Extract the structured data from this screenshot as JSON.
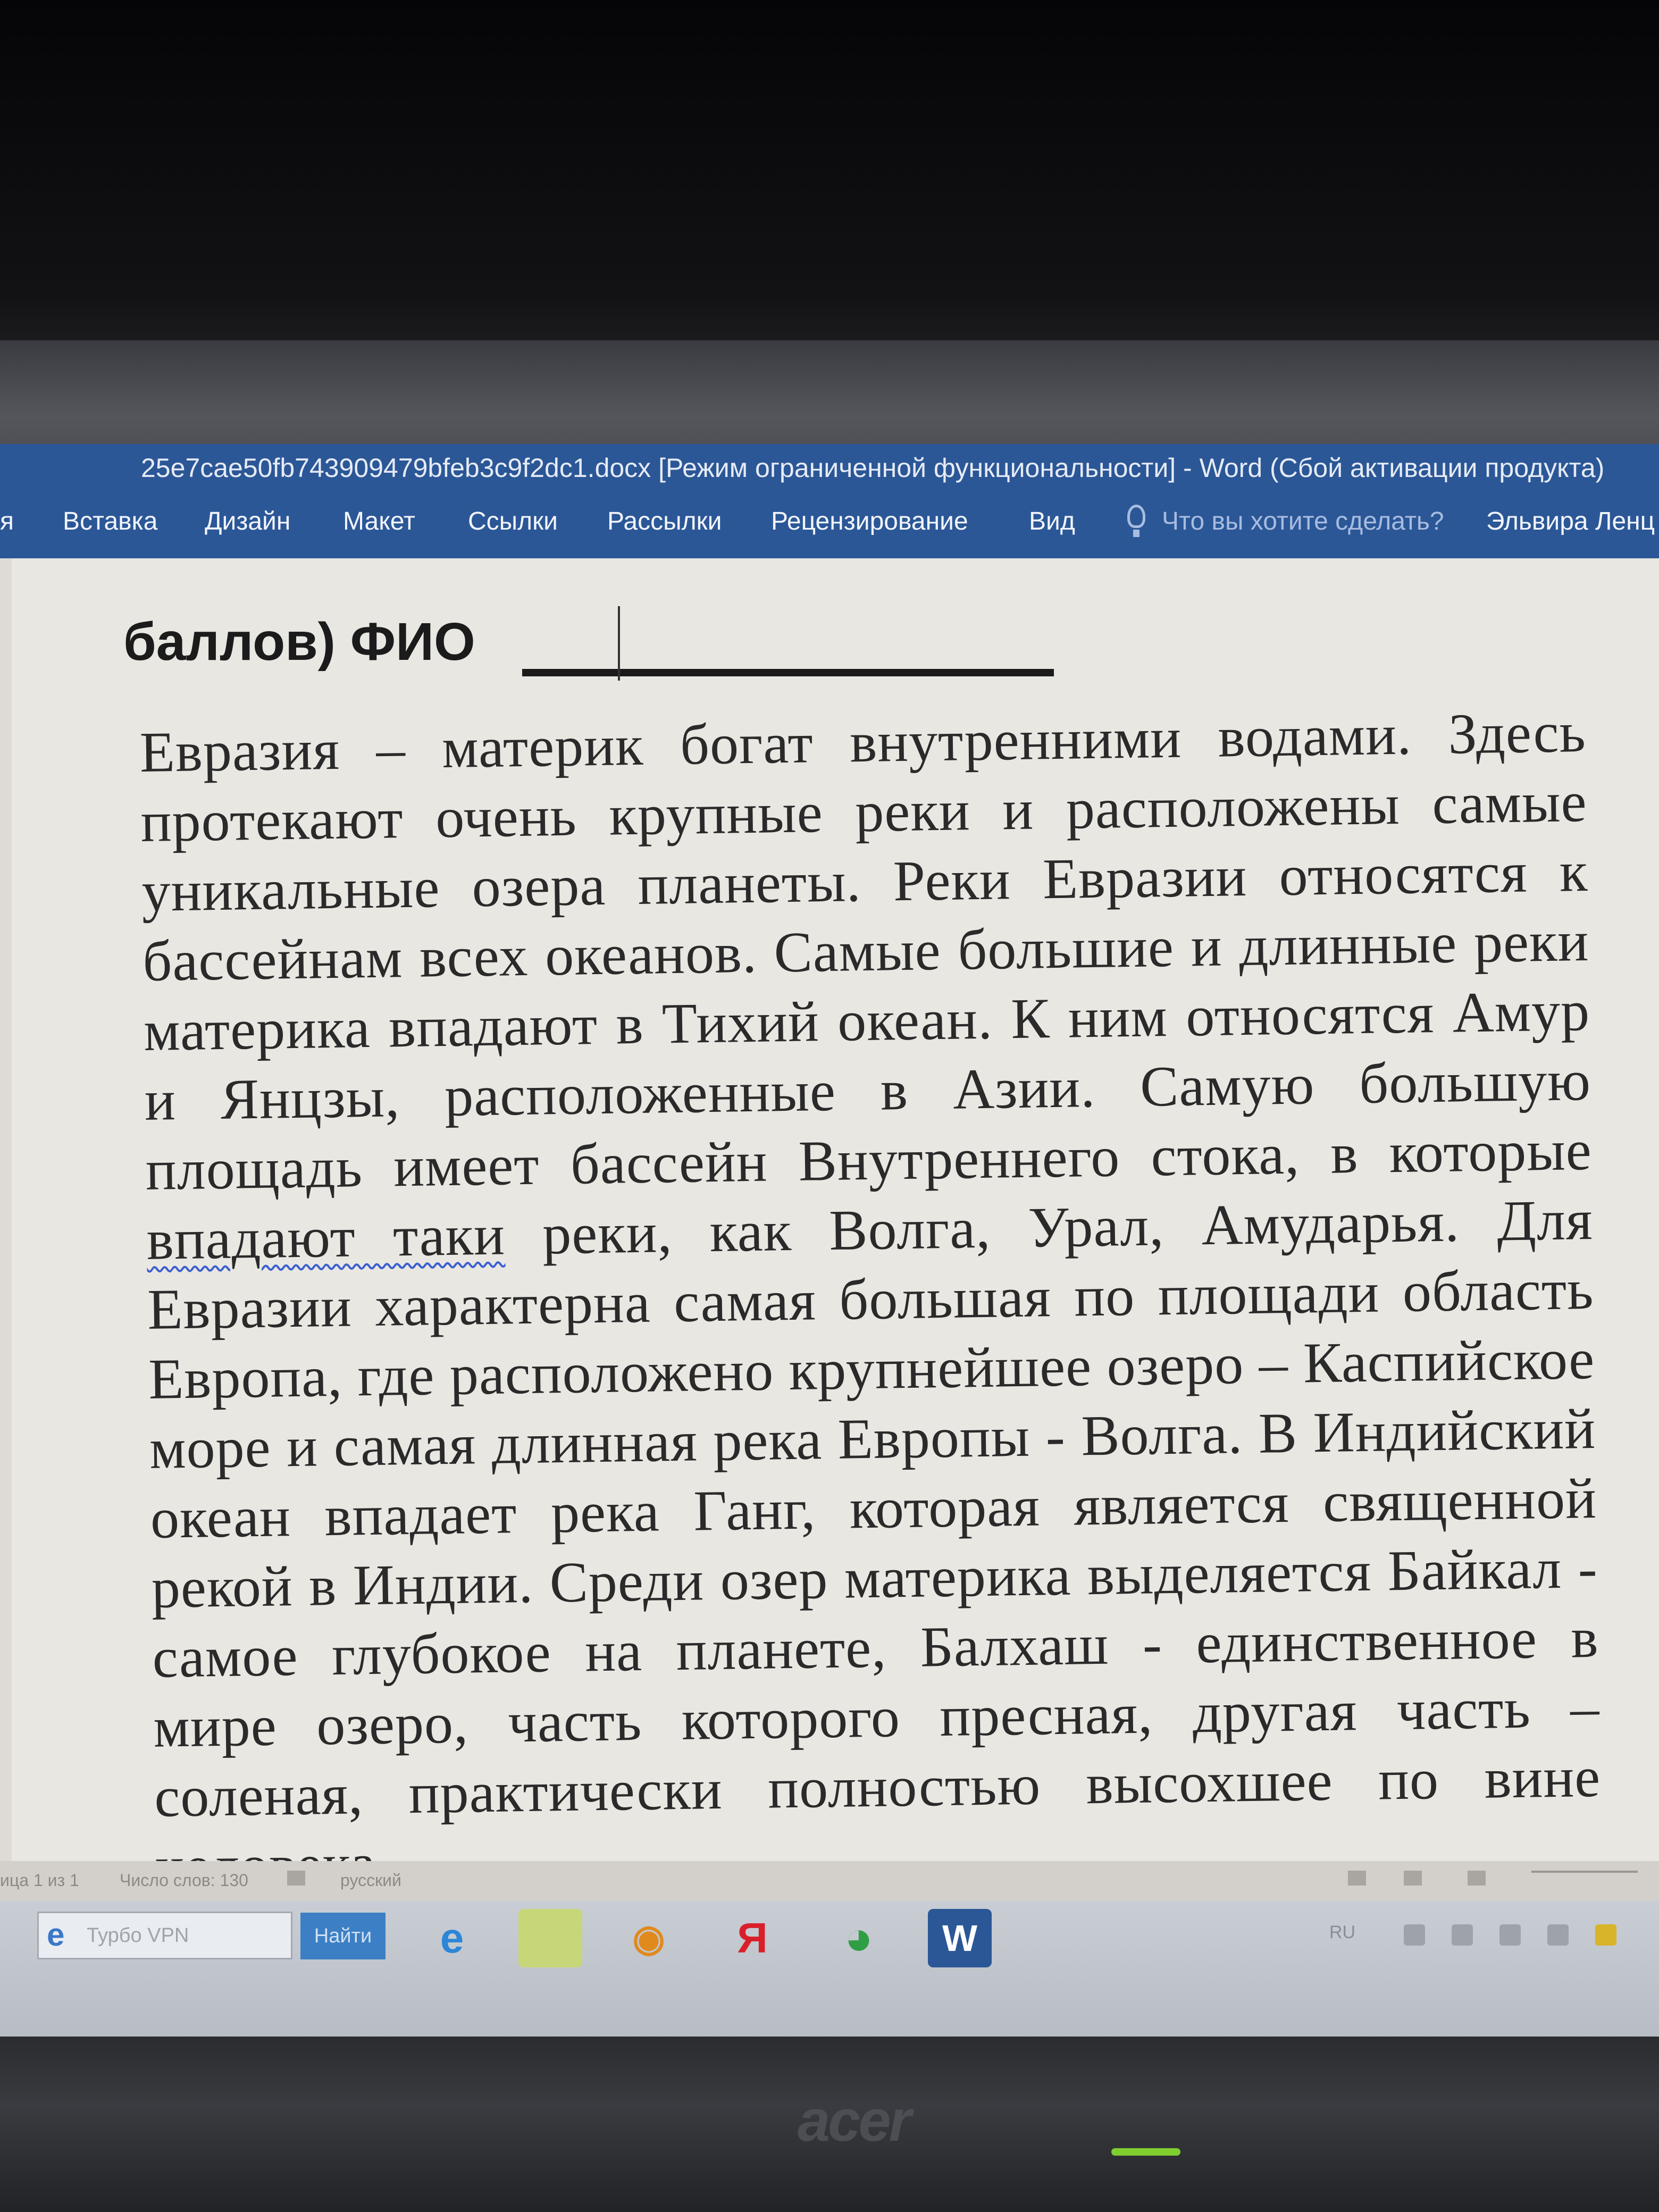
{
  "window": {
    "title": "25e7cae50fb743909479bfeb3c9f2dc1.docx [Режим ограниченной функциональности] - Word (Сбой активации продукта)"
  },
  "ribbon": {
    "tabs": [
      "я",
      "Вставка",
      "Дизайн",
      "Макет",
      "Ссылки",
      "Рассылки",
      "Рецензирование",
      "Вид"
    ],
    "search_prompt": "Что вы хотите сделать?",
    "user": "Эльвира Ленц"
  },
  "document": {
    "header": "баллов)  ФИО",
    "body_part1": "Евразия – материк богат внутренними водами. Здесь протекают очень крупные реки и расположены самые уникальные озера планеты. Реки Евразии относятся к бассейнам всех океанов. Самые большие и длинные реки материка впадают в Тихий океан. К ним относятся Амур и Янцзы, расположенные в Азии. Самую большую площадь имеет бассейн Внутреннего стока, в которые",
    "body_misspelled": "впадают таки",
    "body_part2": "реки, как Волга, Урал, Амударья. Для Евразии характерна самая большая по площади область Европа, где расположено крупнейшее озеро – Каспийское море и самая длинная река Европы - Волга. В Индийский океан впадает река Ганг, которая является священной рекой в Индии. Среди озер материка выделяется Байкал - самое глубокое на планете, Балхаш - единственное в мире озеро, часть которого пресная, другая часть – соленая, практически полностью высохшее по вине человека."
  },
  "statusbar": {
    "page": "ица 1 из 1",
    "words": "Число слов: 130",
    "language": "русский"
  },
  "taskbar": {
    "search_placeholder": "Турбо VPN",
    "search_button": "Найти",
    "tray_lang": "RU"
  },
  "monitor": {
    "brand": "acer"
  },
  "colors": {
    "ribbon": "#2b5797",
    "page": "#e9e7e2",
    "led": "#7fcf2e"
  }
}
